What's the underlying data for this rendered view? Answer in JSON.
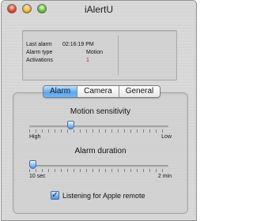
{
  "window": {
    "title": "iAlertU"
  },
  "status": {
    "last_alarm_label": "Last alarm",
    "last_alarm_value": "02:16:19 PM",
    "alarm_type_label": "Alarm type",
    "alarm_type_value": "Motion",
    "activations_label": "Activations",
    "activations_value": "1"
  },
  "tabs": [
    {
      "label": "Alarm",
      "selected": true
    },
    {
      "label": "Camera",
      "selected": false
    },
    {
      "label": "General",
      "selected": false
    }
  ],
  "motion": {
    "title": "Motion sensitivity",
    "min_label": "High",
    "max_label": "Low",
    "value_fraction": 0.29
  },
  "duration": {
    "title": "Alarm duration",
    "min_label": "10 sec",
    "max_label": "2 min",
    "value_fraction": 0.0
  },
  "remote": {
    "label": "Listening for Apple remote",
    "checked": true
  },
  "colors": {
    "accent": "#5aa6f0",
    "activations": "#e01818"
  }
}
